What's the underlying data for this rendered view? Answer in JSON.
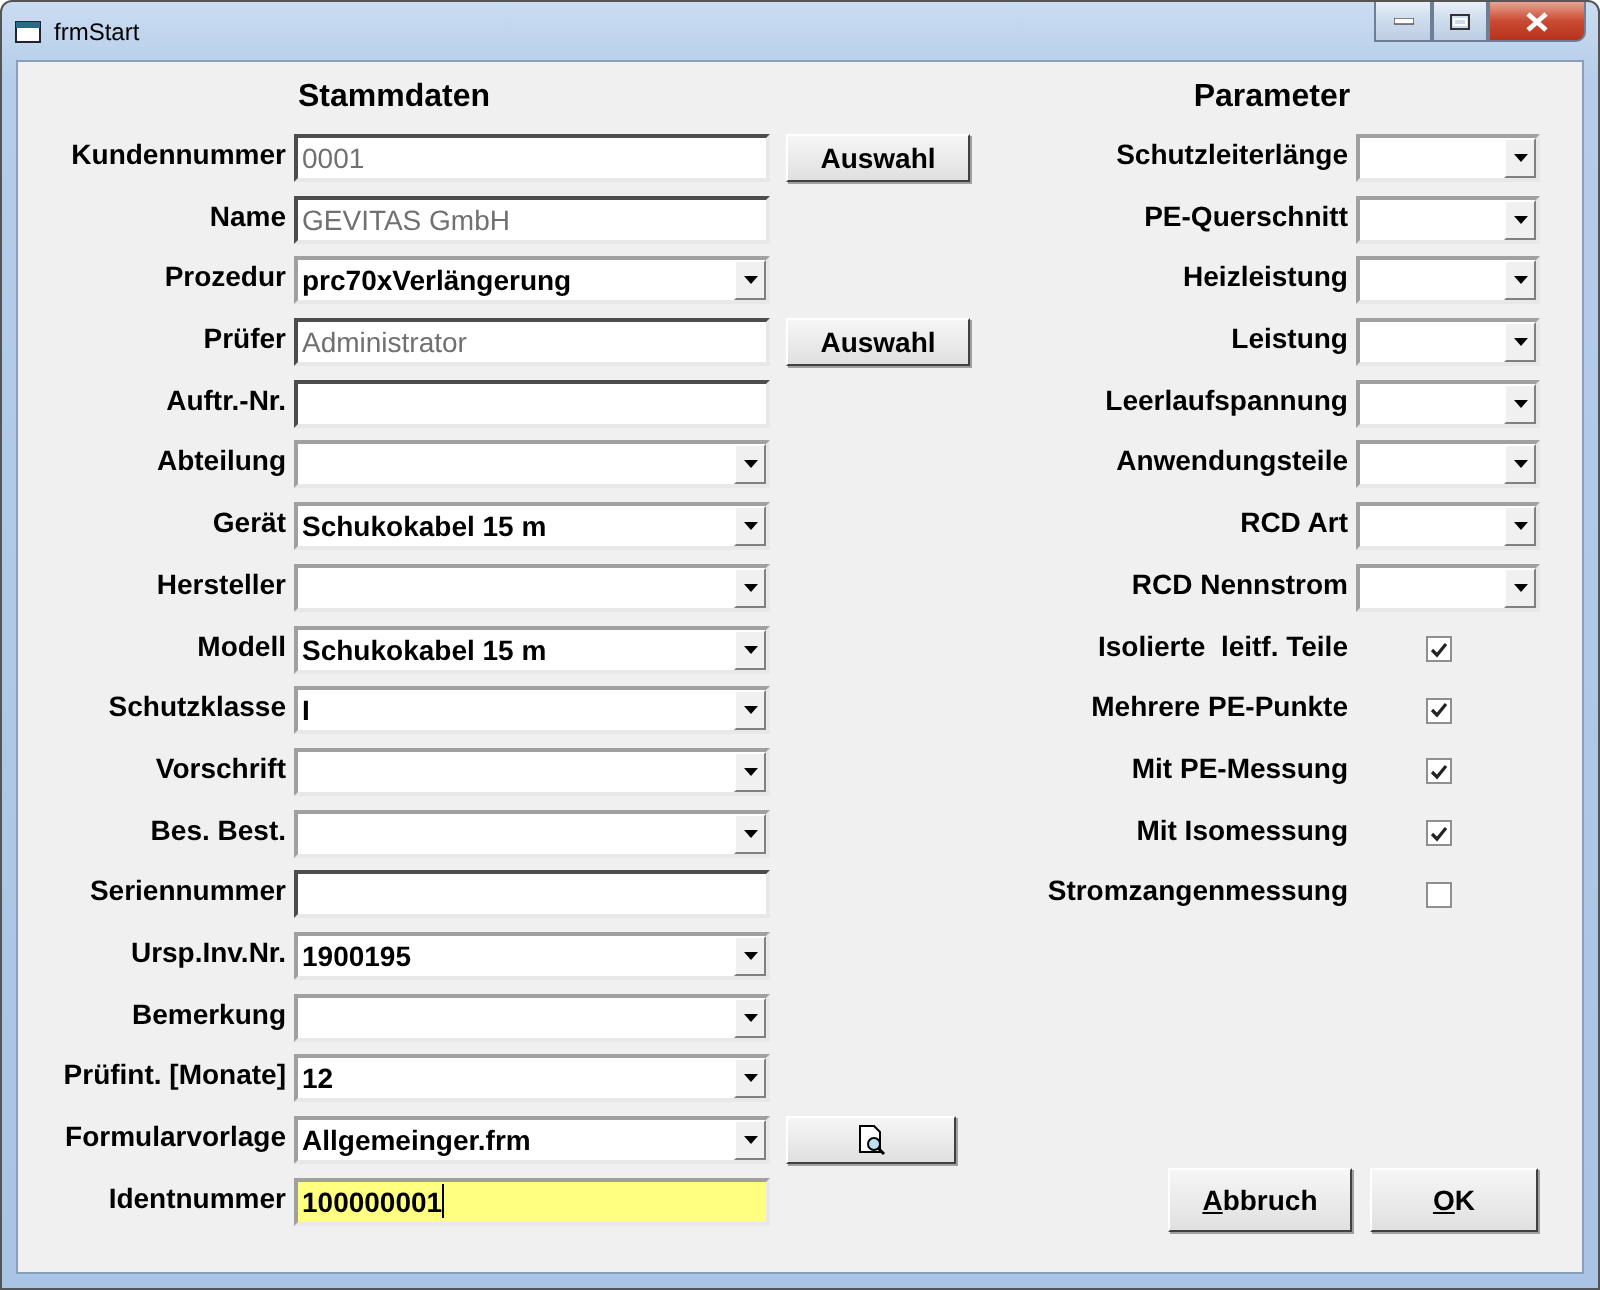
{
  "window": {
    "title": "frmStart"
  },
  "stammdaten": {
    "heading": "Stammdaten",
    "fields": [
      {
        "label": "Kundennummer",
        "kind": "text",
        "value": "0001",
        "locked": true,
        "action": {
          "kind": "text",
          "label": "Auswahl"
        }
      },
      {
        "label": "Name",
        "kind": "text",
        "value": "GEVITAS GmbH",
        "locked": true
      },
      {
        "label": "Prozedur",
        "kind": "combo",
        "value": "prc70xVerlängerung"
      },
      {
        "label": "Prüfer",
        "kind": "text",
        "value": "Administrator",
        "locked": true,
        "action": {
          "kind": "text",
          "label": "Auswahl"
        }
      },
      {
        "label": "Auftr.-Nr.",
        "kind": "text"
      },
      {
        "label": "Abteilung",
        "kind": "combo"
      },
      {
        "label": "Gerät",
        "kind": "combo",
        "value": "Schukokabel 15 m"
      },
      {
        "label": "Hersteller",
        "kind": "combo"
      },
      {
        "label": "Modell",
        "kind": "combo",
        "value": "Schukokabel 15 m"
      },
      {
        "label": "Schutzklasse",
        "kind": "combo",
        "value": "I"
      },
      {
        "label": "Vorschrift",
        "kind": "combo"
      },
      {
        "label": "Bes. Best.",
        "kind": "combo"
      },
      {
        "label": "Seriennummer",
        "kind": "text"
      },
      {
        "label": "Ursp.Inv.Nr.",
        "kind": "combo",
        "value": "1900195"
      },
      {
        "label": "Bemerkung",
        "kind": "combo"
      },
      {
        "label": "Prüfint. [Monate]",
        "kind": "combo",
        "value": "12"
      },
      {
        "label": "Formularvorlage",
        "kind": "combo",
        "value": "Allgemeinger.frm",
        "action": {
          "kind": "preview"
        }
      },
      {
        "label": "Identnummer",
        "kind": "text",
        "value": "100000001",
        "focused": true
      }
    ]
  },
  "parameter": {
    "heading": "Parameter",
    "fields": [
      {
        "label": "Schutzleiterlänge",
        "kind": "combo"
      },
      {
        "label": "PE-Querschnitt",
        "kind": "combo"
      },
      {
        "label": "Heizleistung",
        "kind": "combo"
      },
      {
        "label": "Leistung",
        "kind": "combo"
      },
      {
        "label": "Leerlaufspannung",
        "kind": "combo"
      },
      {
        "label": "Anwendungsteile",
        "kind": "combo"
      },
      {
        "label": "RCD Art",
        "kind": "combo"
      },
      {
        "label": "RCD Nennstrom",
        "kind": "combo"
      }
    ],
    "checks": [
      {
        "label": "Isolierte  leitf. Teile",
        "checked": true
      },
      {
        "label": "Mehrere PE-Punkte",
        "checked": true
      },
      {
        "label": "Mit PE-Messung",
        "checked": true
      },
      {
        "label": "Mit Isomessung",
        "checked": true
      },
      {
        "label": "Stromzangenmessung",
        "checked": false
      }
    ]
  },
  "buttons": [
    {
      "label": "Abbruch",
      "mnemonic": true
    },
    {
      "label": "OK",
      "mnemonic": true
    }
  ]
}
